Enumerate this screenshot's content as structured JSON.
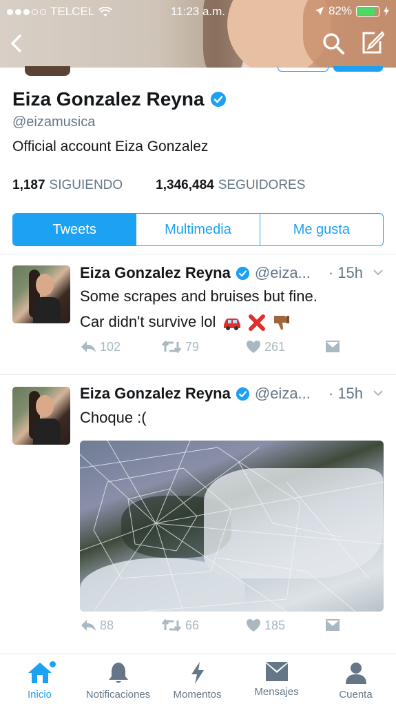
{
  "status_bar": {
    "carrier": "TELCEL",
    "time": "11:23 a.m.",
    "battery": "82%",
    "battery_level": 0.82
  },
  "profile": {
    "name": "Eiza Gonzalez Reyna",
    "handle": "@eizamusica",
    "bio": "Official account Eiza Gonzalez",
    "following_count": "1,187",
    "following_label": "SIGUIENDO",
    "followers_count": "1,346,484",
    "followers_label": "SEGUIDORES"
  },
  "profile_tabs": [
    {
      "label": "Tweets",
      "active": true
    },
    {
      "label": "Multimedia",
      "active": false
    },
    {
      "label": "Me gusta",
      "active": false
    }
  ],
  "tweets": [
    {
      "name": "Eiza Gonzalez Reyna",
      "handle": "@eiza...",
      "time": "· 15h",
      "text_line1": "Some scrapes and bruises but fine.",
      "text_line2": "Car didn't survive lol",
      "replies": "102",
      "retweets": "79",
      "likes": "261"
    },
    {
      "name": "Eiza Gonzalez Reyna",
      "handle": "@eiza...",
      "time": "· 15h",
      "text_line1": "Choque :(",
      "replies": "88",
      "retweets": "66",
      "likes": "185"
    }
  ],
  "tab_bar": [
    {
      "label": "Inicio",
      "icon": "home-icon",
      "active": true
    },
    {
      "label": "Notificaciones",
      "icon": "bell-icon",
      "active": false
    },
    {
      "label": "Momentos",
      "icon": "lightning-icon",
      "active": false
    },
    {
      "label": "Mensajes",
      "icon": "envelope-icon",
      "active": false
    },
    {
      "label": "Cuenta",
      "icon": "person-icon",
      "active": false
    }
  ],
  "colors": {
    "accent": "#1da1f2",
    "muted": "#657786",
    "action_gray": "#aab8c2"
  }
}
